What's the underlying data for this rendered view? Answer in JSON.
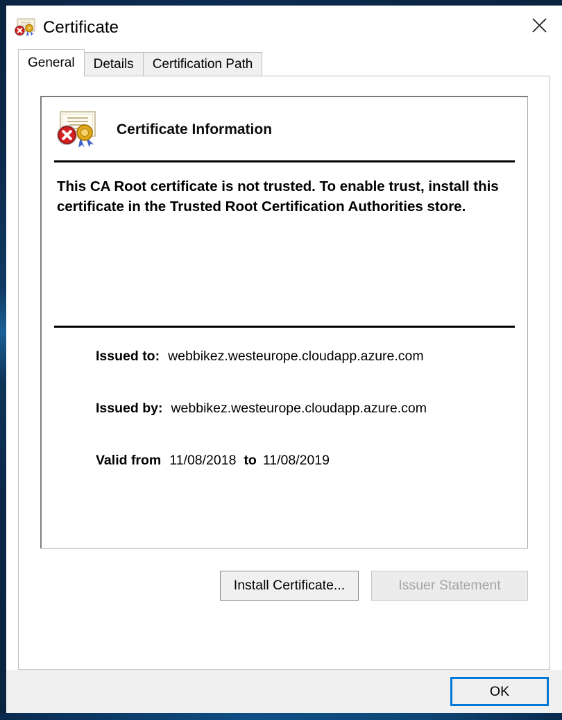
{
  "window": {
    "title": "Certificate",
    "title_icon": "certificate-error-icon",
    "close_icon": "close-icon"
  },
  "tabs": [
    {
      "label": "General",
      "active": true
    },
    {
      "label": "Details",
      "active": false
    },
    {
      "label": "Certification Path",
      "active": false
    }
  ],
  "panel": {
    "icon": "certificate-error-icon",
    "heading": "Certificate Information",
    "warning": "This CA Root certificate is not trusted. To enable trust, install this certificate in the Trusted Root Certification Authorities store.",
    "fields": [
      {
        "label": "Issued to:",
        "value": "webbikez.westeurope.cloudapp.azure.com"
      },
      {
        "label": "Issued by:",
        "value": "webbikez.westeurope.cloudapp.azure.com"
      }
    ],
    "validity": {
      "label": "Valid from",
      "from": "11/08/2018",
      "separator": "to",
      "to": "11/08/2019"
    }
  },
  "buttons": {
    "install": {
      "label": "Install Certificate...",
      "enabled": true
    },
    "issuer": {
      "label": "Issuer Statement",
      "enabled": false
    },
    "ok": {
      "label": "OK",
      "focused": true
    }
  },
  "colors": {
    "accent": "#0078d7",
    "title_bar_bg": "#ffffff",
    "footer_bg": "#f0f0f0",
    "panel_bg": "#ffffff",
    "error_red": "#d32020",
    "seal_gold": "#e3a81b",
    "behind_window_navy": "#0a2340"
  }
}
